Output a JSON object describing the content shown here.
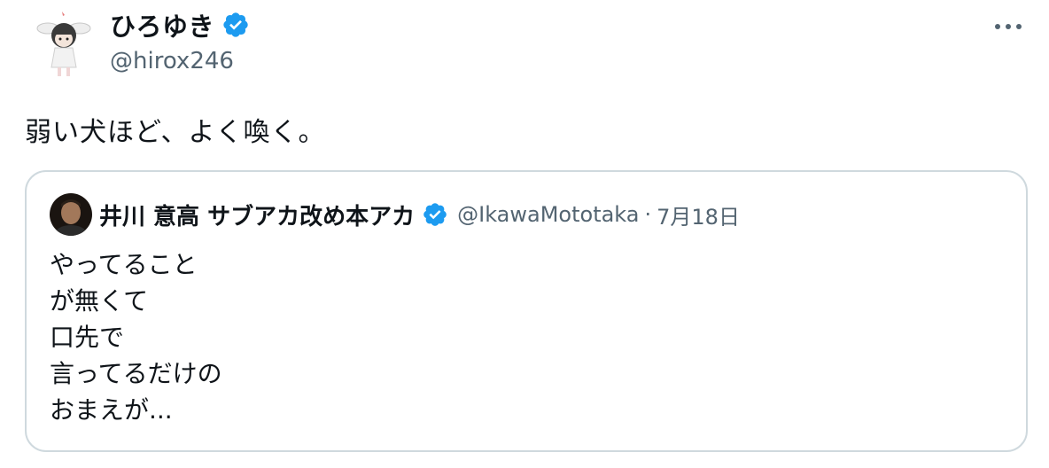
{
  "author": {
    "display_name": "ひろゆき",
    "handle": "@hirox246",
    "verified_badge": "verified-badge-icon"
  },
  "tweet": {
    "text": "弱い犬ほど、よく喚く。"
  },
  "quoted_tweet": {
    "display_name": "井川 意高 サブアカ改め本アカ",
    "handle": "@IkawaMototaka",
    "separator": "·",
    "date": "7月18日",
    "lines": [
      "やってること",
      "が無くて",
      "口先で",
      "言ってるだけの",
      "おまえが..."
    ]
  },
  "colors": {
    "verified_blue": "#1d9bf0",
    "secondary_text": "#536471",
    "border": "#cfd9de"
  }
}
